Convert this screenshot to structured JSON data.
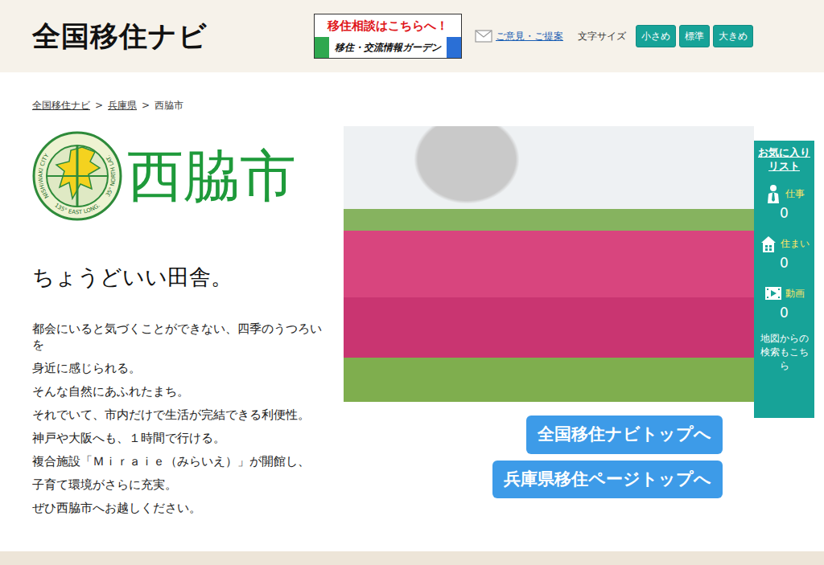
{
  "site_title": "全国移住ナビ",
  "banner": {
    "line1": "移住相談はこちらへ！",
    "line2": "移住・交流情報ガーデン"
  },
  "feedback_link": "ご意見・ご提案",
  "font_size": {
    "label": "文字サイズ",
    "options": [
      {
        "label": "小さめ",
        "selected": false
      },
      {
        "label": "標準",
        "selected": false
      },
      {
        "label": "大きめ",
        "selected": false
      }
    ]
  },
  "breadcrumb": {
    "separator": ">",
    "items": [
      {
        "label": "全国移住ナビ",
        "link": true
      },
      {
        "label": "兵庫県",
        "link": true
      },
      {
        "label": "西脇市",
        "link": false
      }
    ]
  },
  "city": {
    "name": "西脇市",
    "logo_text_left": "NISHIWAKI CITY",
    "logo_text_bottom": "135° EAST LONG.",
    "logo_text_right": "35° NORTH LAT."
  },
  "catchphrase": "ちょうどいい田舎。",
  "intro_lines": [
    "都会にいると気づくことができない、四季のうつろいを",
    "身近に感じられる。",
    "そんな自然にあふれたまち。",
    "それでいて、市内だけで生活が完結できる利便性。",
    "神戸や大阪へも、１時間で行ける。",
    "複合施設「Ｍｉｒａｉｅ（みらいえ）」が開館し、",
    "子育て環境がさらに充実。",
    "ぜひ西脇市へお越しください。"
  ],
  "sidebar": {
    "title": "お気に入りリスト",
    "items": [
      {
        "label": "仕事",
        "count": "0",
        "kind": "job"
      },
      {
        "label": "住まい",
        "count": "0",
        "kind": "house"
      },
      {
        "label": "動画",
        "count": "0",
        "kind": "video"
      }
    ],
    "map_search": "地図からの検索もこちら"
  },
  "buttons": [
    "全国移住ナビトップへ",
    "兵庫県移住ページトップへ"
  ]
}
